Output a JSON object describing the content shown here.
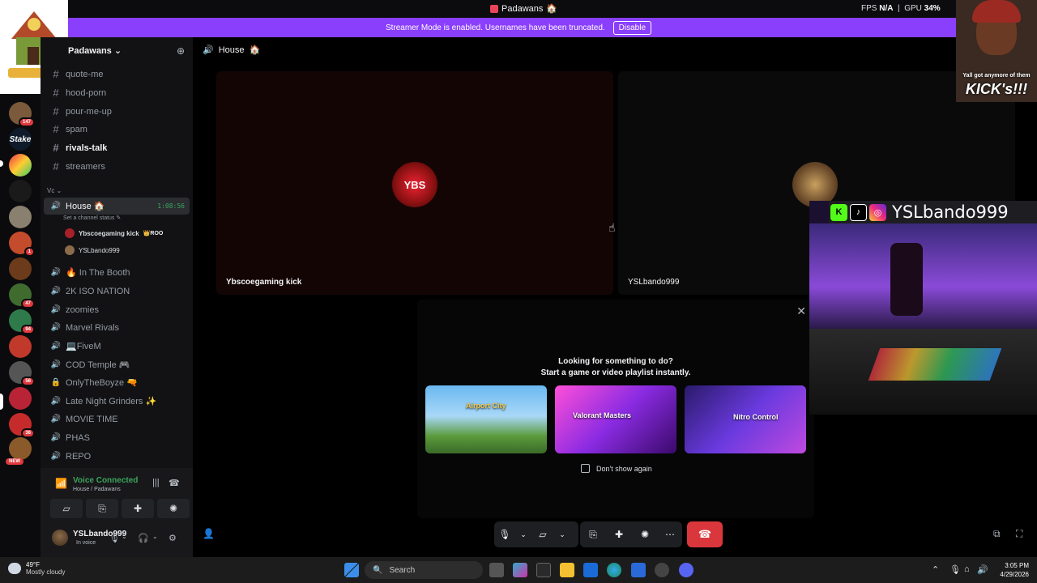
{
  "titlebar": {
    "title": "Padawans",
    "fps_label": "FPS",
    "fps_value": "N/A",
    "gpu_label": "GPU",
    "gpu_value": "34%"
  },
  "banner": {
    "text": "Streamer Mode is enabled. Usernames have been truncated.",
    "disable_label": "Disable"
  },
  "rail": {
    "badges": [
      "147",
      "47",
      "94",
      "56",
      "36",
      "1"
    ],
    "new_label": "NEW",
    "stake_label": "Stake"
  },
  "sidebar": {
    "guild_name": "Padawans",
    "text_channels": [
      {
        "name": "quote-me",
        "bold": false
      },
      {
        "name": "hood-porn",
        "bold": false
      },
      {
        "name": "pour-me-up",
        "bold": false
      },
      {
        "name": "spam",
        "bold": false
      },
      {
        "name": "rivals-talk",
        "bold": true
      },
      {
        "name": "streamers",
        "bold": false
      }
    ],
    "section_label": "Vc",
    "active_voice": {
      "name": "House",
      "duration": "1:08:56",
      "status_placeholder": "Set a channel status",
      "users": [
        {
          "name": "Ybscoegaming kick",
          "tag": "ROO"
        },
        {
          "name": "YSLbando999",
          "tag": ""
        }
      ]
    },
    "voice_channels": [
      "In The Booth",
      "2K ISO NATION",
      "zoomies",
      "Marvel Rivals",
      "FiveM",
      "COD Temple",
      "OnlyTheBoyze",
      "Late Night Grinders",
      "MOVIE TIME",
      "PHAS",
      "REPO"
    ]
  },
  "voicebar": {
    "title": "Voice Connected",
    "subtitle": "House / Padawans",
    "username": "YSLbando999",
    "user_status": "In voice"
  },
  "main": {
    "channel_title": "House",
    "tiles": [
      {
        "name": "Ybscoegaming kick",
        "avatar_text": "YBS"
      },
      {
        "name": "YSLbando999"
      }
    ],
    "activity": {
      "title_line1": "Looking for something to do?",
      "title_line2": "Start a game or video playlist instantly.",
      "cards": [
        {
          "name": "Airport City",
          "accent": "#f2c94c"
        },
        {
          "name": "Valorant Masters",
          "accent": "#9b4dff"
        },
        {
          "name": "Nitro Control",
          "accent": "#5865f2"
        }
      ],
      "dont_show": "Don't show again"
    }
  },
  "overlay": {
    "webcam_caption_top": "Yall got anymore of them",
    "webcam_caption_big": "KICK's!!!",
    "promo_handle": "YSLbando999"
  },
  "taskbar": {
    "temperature": "49°F",
    "weather": "Mostly cloudy",
    "search_placeholder": "Search",
    "time": "3:05 PM",
    "date": "4/29/2026"
  },
  "colors": {
    "banner": "#8a3ffc",
    "voice_green": "#3ba55c",
    "hangup_red": "#da373c"
  }
}
